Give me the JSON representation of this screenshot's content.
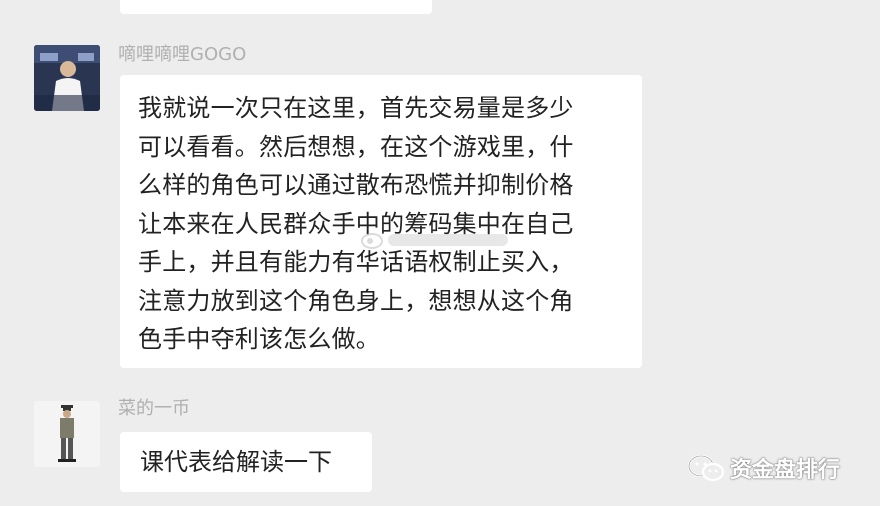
{
  "messages": [
    {
      "sender": "嘀哩嘀哩GOGO",
      "lines": [
        "我就说一次只在这里，首先交易量是多少",
        "可以看看。然后想想，在这个游戏里，什",
        "么样的角色可以通过散布恐慌并抑制价格",
        "让本来在人民群众手中的筹码集中在自己",
        "手上，并且有能力有华话语权制止买入，",
        "注意力放到这个角色身上，想想从这个角",
        "色手中夺利该怎么做。"
      ]
    },
    {
      "sender": "菜的一币",
      "text": "课代表给解读一下"
    }
  ],
  "watermark": {
    "text": "资金盘排行",
    "icon": "wechat-icon"
  },
  "colors": {
    "background": "#ededed",
    "bubble": "#ffffff",
    "sender_text": "#b0b0b0",
    "message_text": "#222222"
  }
}
